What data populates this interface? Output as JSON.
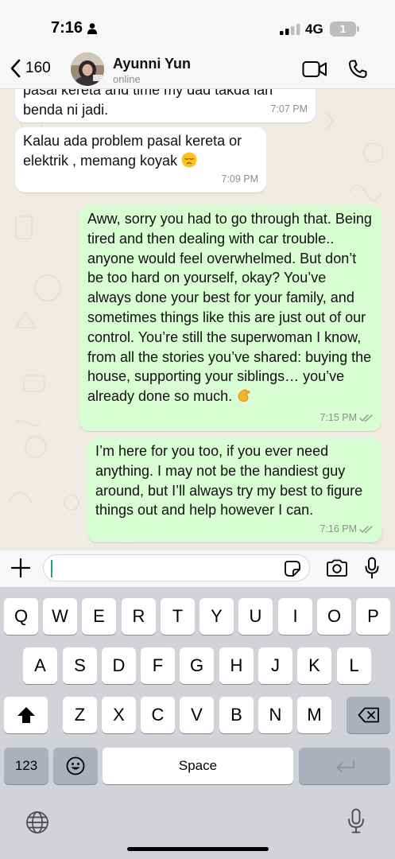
{
  "status_bar": {
    "time": "7:16",
    "network": "4G",
    "battery_level": "1"
  },
  "header": {
    "back_count": "160",
    "contact_name": "Ayunni Yun",
    "contact_status": "online",
    "icons": [
      "chevron-left-icon",
      "video-call-icon",
      "phone-icon"
    ]
  },
  "messages": [
    {
      "direction": "incoming",
      "text": "pasal kereta and time my dad takda lah benda ni jadi.",
      "time": "7:07 PM"
    },
    {
      "direction": "incoming",
      "text": "Kalau ada problem pasal kereta or elektrik , memang koyak",
      "emoji": "pensive-face",
      "time": "7:09 PM"
    },
    {
      "direction": "outgoing",
      "text": "Aww, sorry you had to go through that. Being tired and then dealing with car trouble.. anyone would feel overwhelmed. But don’t be too hard on yourself, okay? You’ve always done your best for your family, and sometimes things like this are just out of our control. You’re still the superwoman I know, from all the stories you’ve shared: buying the house, supporting your siblings… you’ve already done so much.",
      "emoji": "pinched-fingers",
      "time": "7:15 PM",
      "read": true
    },
    {
      "direction": "outgoing",
      "text": "I’m here for you too, if you ever need anything. I may not be the handiest guy around, but I’ll always try my best to figure things out and help however I can.",
      "time": "7:16 PM",
      "read": true
    }
  ],
  "input": {
    "value": "",
    "icons": [
      "plus-icon",
      "sticker-icon",
      "camera-icon",
      "mic-icon"
    ]
  },
  "keyboard": {
    "row1": [
      "Q",
      "W",
      "E",
      "R",
      "T",
      "Y",
      "U",
      "I",
      "O",
      "P"
    ],
    "row2": [
      "A",
      "S",
      "D",
      "F",
      "G",
      "H",
      "J",
      "K",
      "L"
    ],
    "row3": [
      "Z",
      "X",
      "C",
      "V",
      "B",
      "N",
      "M"
    ],
    "numbers_key": "123",
    "space_key": "Space",
    "icons": [
      "shift-icon",
      "backspace-icon",
      "emoji-icon",
      "return-icon",
      "globe-icon",
      "dictation-mic-icon"
    ]
  },
  "colors": {
    "outgoing_bubble": "#d9fdd3",
    "incoming_bubble": "#ffffff",
    "wallpaper": "#efeae2",
    "accent": "#25a36b"
  }
}
